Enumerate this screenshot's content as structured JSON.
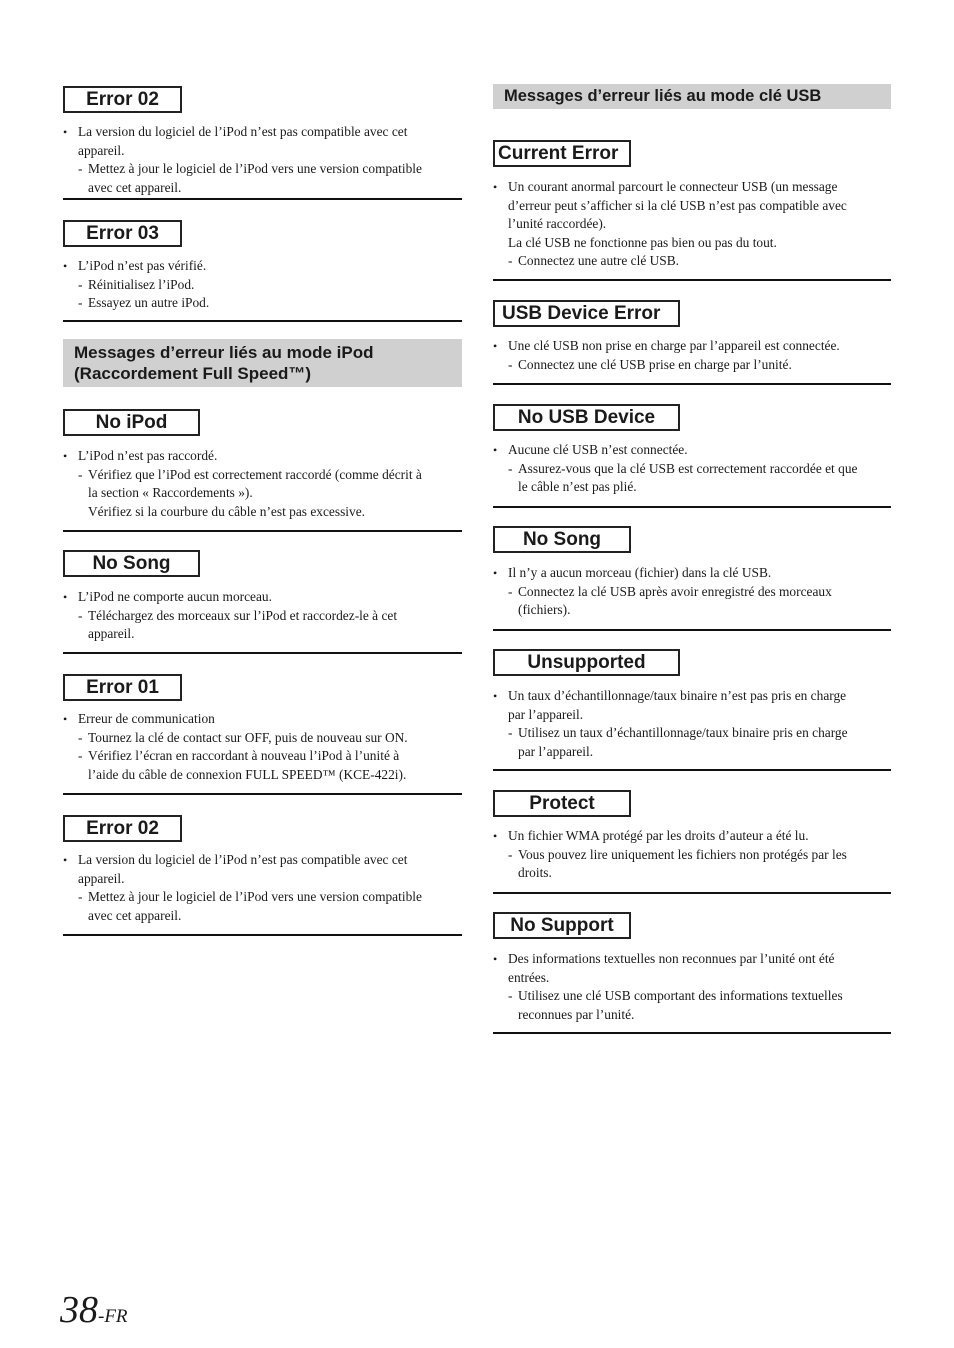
{
  "left_column": {
    "error02_top": {
      "label": "Error 02",
      "lines": [
        {
          "type": "bullet",
          "text": "La version du logiciel de l’iPod n’est pas compatible avec cet"
        },
        {
          "type": "plain",
          "text": "appareil."
        },
        {
          "type": "dash",
          "text": "Mettez à jour le logiciel de l’iPod vers une version compatible"
        },
        {
          "type": "plain2",
          "text": "avec cet appareil."
        }
      ]
    },
    "error03": {
      "label": "Error 03",
      "lines": [
        {
          "type": "bullet",
          "text": "L’iPod n’est pas vérifié."
        },
        {
          "type": "dash",
          "text": "Réinitialisez l’iPod."
        },
        {
          "type": "dash",
          "text": "Essayez un autre iPod."
        }
      ]
    },
    "ipod_section": {
      "title_line1": "Messages d’erreur liés au mode iPod",
      "title_line2": "(Raccordement Full Speed™)"
    },
    "no_ipod": {
      "label": "No iPod",
      "lines": [
        {
          "type": "bullet",
          "text": "L’iPod n’est pas raccordé."
        },
        {
          "type": "dash",
          "text": "Vérifiez que l’iPod est correctement raccordé (comme décrit à"
        },
        {
          "type": "plain2",
          "text": "la section « Raccordements »)."
        },
        {
          "type": "plain2",
          "text": "Vérifiez si la courbure du câble n’est pas excessive."
        }
      ]
    },
    "no_song": {
      "label": "No Song",
      "lines": [
        {
          "type": "bullet",
          "text": "L’iPod ne comporte aucun morceau."
        },
        {
          "type": "dash",
          "text": "Téléchargez des morceaux sur l’iPod et raccordez-le à cet"
        },
        {
          "type": "plain2",
          "text": "appareil."
        }
      ]
    },
    "error01": {
      "label": "Error 01",
      "lines": [
        {
          "type": "bullet",
          "text": "Erreur de communication"
        },
        {
          "type": "dash",
          "text": "Tournez la clé de contact sur OFF, puis de nouveau sur ON."
        },
        {
          "type": "dash",
          "text": "Vérifiez l’écran en raccordant à nouveau l’iPod à l’unité à"
        },
        {
          "type": "plain2",
          "text": "l’aide du câble de connexion FULL SPEED™ (KCE-422i)."
        }
      ]
    },
    "error02_bottom": {
      "label": "Error 02",
      "lines": [
        {
          "type": "bullet",
          "text": "La version du logiciel de l’iPod n’est pas compatible avec cet"
        },
        {
          "type": "plain",
          "text": "appareil."
        },
        {
          "type": "dash",
          "text": "Mettez à jour le logiciel de l’iPod vers une version compatible"
        },
        {
          "type": "plain2",
          "text": "avec cet appareil."
        }
      ]
    }
  },
  "right_column": {
    "usb_section": {
      "title": "Messages d’erreur liés au mode clé USB"
    },
    "current_error": {
      "label": "Current Error",
      "lines": [
        {
          "type": "bullet",
          "text": "Un courant anormal parcourt le connecteur USB (un message"
        },
        {
          "type": "plain",
          "text": "d’erreur peut s’afficher si la clé USB n’est pas compatible avec"
        },
        {
          "type": "plain",
          "text": "l’unité raccordée)."
        },
        {
          "type": "plain",
          "text": "La clé USB ne fonctionne pas bien ou pas du tout."
        },
        {
          "type": "dash",
          "text": "Connectez une autre clé USB."
        }
      ]
    },
    "usb_device_error": {
      "label": "USB Device Error",
      "lines": [
        {
          "type": "bullet",
          "text": "Une clé USB non prise en charge par l’appareil est connectée."
        },
        {
          "type": "dash",
          "text": "Connectez une clé USB prise en charge par l’unité."
        }
      ]
    },
    "no_usb_device": {
      "label": "No USB Device",
      "lines": [
        {
          "type": "bullet",
          "text": "Aucune clé USB n’est connectée."
        },
        {
          "type": "dash",
          "text": "Assurez-vous que la clé USB est correctement raccordée et que"
        },
        {
          "type": "plain2",
          "text": "le câble n’est pas plié."
        }
      ]
    },
    "no_song": {
      "label": "No Song",
      "lines": [
        {
          "type": "bullet",
          "text": "Il n’y a aucun morceau (fichier) dans la clé USB."
        },
        {
          "type": "dash",
          "text": "Connectez la clé USB après avoir enregistré des morceaux"
        },
        {
          "type": "plain2",
          "text": "(fichiers)."
        }
      ]
    },
    "unsupported": {
      "label": "Unsupported",
      "lines": [
        {
          "type": "bullet",
          "text": "Un taux d’échantillonnage/taux binaire n’est pas pris en charge"
        },
        {
          "type": "plain",
          "text": "par l’appareil."
        },
        {
          "type": "dash",
          "text": "Utilisez un taux d’échantillonnage/taux binaire pris en charge"
        },
        {
          "type": "plain2",
          "text": "par l’appareil."
        }
      ]
    },
    "protect": {
      "label": "Protect",
      "lines": [
        {
          "type": "bullet",
          "text": "Un fichier WMA protégé par les droits d’auteur a été lu."
        },
        {
          "type": "dash",
          "text": "Vous pouvez lire uniquement les fichiers non protégés par les"
        },
        {
          "type": "plain2",
          "text": "droits."
        }
      ]
    },
    "no_support": {
      "label": "No Support",
      "lines": [
        {
          "type": "bullet",
          "text": "Des informations textuelles non reconnues par l’unité ont été"
        },
        {
          "type": "plain",
          "text": "entrées."
        },
        {
          "type": "dash",
          "text": "Utilisez une clé USB comportant des informations textuelles"
        },
        {
          "type": "plain2",
          "text": "reconnues par l’unité."
        }
      ]
    }
  },
  "footer": {
    "page_number": "38",
    "language_suffix": "-FR"
  }
}
